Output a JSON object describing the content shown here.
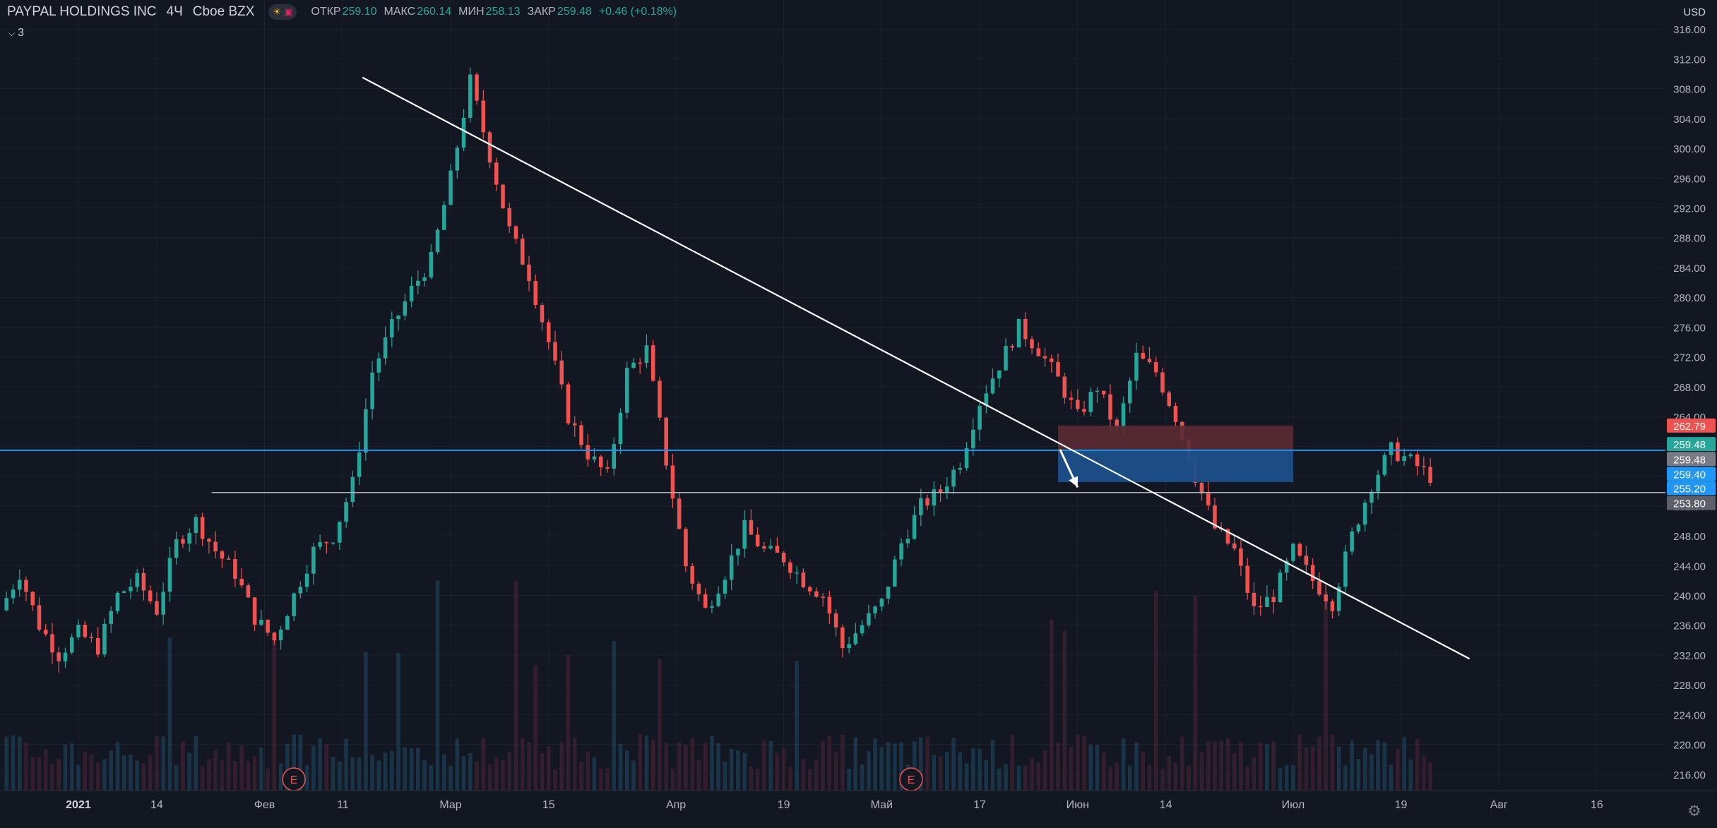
{
  "header": {
    "symbol": "PAYPAL HOLDINGS INC",
    "timeframe": "4Ч",
    "exchange": "Cboe BZX",
    "badge_icons": [
      "sun-icon",
      "flag-icon"
    ],
    "open_label": "ОТКР",
    "open_value": "259.10",
    "high_label": "МАКС",
    "high_value": "260.14",
    "low_label": "МИН",
    "low_value": "258.13",
    "close_label": "ЗАКР",
    "close_value": "259.48",
    "change": "+0.46 (+0.18%)",
    "indicators_count": "3"
  },
  "colors": {
    "background": "#131722",
    "up": "#26a69a",
    "down": "#ef5350",
    "trendline": "#ffffff",
    "hline_blue": "#2196f3",
    "hline_gray": "#b2b5be",
    "stop_zone": "#5b2a33",
    "target_zone": "#1c4f8a"
  },
  "chart_data": {
    "type": "candlestick",
    "currency": "USD",
    "ylim": [
      214,
      318
    ],
    "y_ticks": [
      "316.00",
      "312.00",
      "308.00",
      "304.00",
      "300.00",
      "296.00",
      "292.00",
      "288.00",
      "284.00",
      "280.00",
      "276.00",
      "272.00",
      "268.00",
      "264.00",
      "260.00",
      "256.00",
      "252.00",
      "248.00",
      "244.00",
      "240.00",
      "236.00",
      "232.00",
      "228.00",
      "224.00",
      "220.00",
      "216.00"
    ],
    "x_range": [
      0,
      85
    ],
    "x_ticks": [
      {
        "label": "2021",
        "x": 4,
        "bold": true
      },
      {
        "label": "14",
        "x": 8
      },
      {
        "label": "Фев",
        "x": 13.5
      },
      {
        "label": "11",
        "x": 17.5
      },
      {
        "label": "Мар",
        "x": 23
      },
      {
        "label": "15",
        "x": 28
      },
      {
        "label": "Апр",
        "x": 34.5
      },
      {
        "label": "19",
        "x": 40
      },
      {
        "label": "Май",
        "x": 45
      },
      {
        "label": "17",
        "x": 50
      },
      {
        "label": "Июн",
        "x": 55
      },
      {
        "label": "14",
        "x": 59.5
      },
      {
        "label": "Июл",
        "x": 66
      },
      {
        "label": "19",
        "x": 71.5
      },
      {
        "label": "Авг",
        "x": 76.5
      },
      {
        "label": "16",
        "x": 81.5
      }
    ],
    "closes": [
      [
        0,
        238
      ],
      [
        1,
        243
      ],
      [
        2,
        236
      ],
      [
        3,
        232
      ],
      [
        4,
        235
      ],
      [
        5,
        233
      ],
      [
        6,
        240
      ],
      [
        7,
        242
      ],
      [
        8,
        238
      ],
      [
        9,
        247
      ],
      [
        10,
        250
      ],
      [
        11,
        246
      ],
      [
        12,
        243
      ],
      [
        13,
        237
      ],
      [
        14,
        234
      ],
      [
        15,
        240
      ],
      [
        16,
        246
      ],
      [
        17,
        248
      ],
      [
        18,
        255
      ],
      [
        19,
        270
      ],
      [
        20,
        276
      ],
      [
        21,
        281
      ],
      [
        22,
        285
      ],
      [
        23,
        296
      ],
      [
        24,
        309
      ],
      [
        25,
        299
      ],
      [
        26,
        289
      ],
      [
        27,
        283
      ],
      [
        28,
        274
      ],
      [
        29,
        264
      ],
      [
        30,
        259
      ],
      [
        31,
        256
      ],
      [
        32,
        270
      ],
      [
        33,
        273
      ],
      [
        34,
        258
      ],
      [
        35,
        244
      ],
      [
        36,
        238
      ],
      [
        37,
        243
      ],
      [
        38,
        249
      ],
      [
        39,
        246
      ],
      [
        40,
        245
      ],
      [
        41,
        242
      ],
      [
        42,
        240
      ],
      [
        43,
        233
      ],
      [
        44,
        236
      ],
      [
        45,
        239
      ],
      [
        46,
        247
      ],
      [
        47,
        252
      ],
      [
        48,
        254
      ],
      [
        49,
        258
      ],
      [
        50,
        266
      ],
      [
        51,
        271
      ],
      [
        52,
        276
      ],
      [
        53,
        273
      ],
      [
        54,
        269
      ],
      [
        55,
        264
      ],
      [
        56,
        268
      ],
      [
        57,
        262
      ],
      [
        58,
        272
      ],
      [
        59,
        270
      ],
      [
        60,
        264
      ],
      [
        61,
        256
      ],
      [
        62,
        249
      ],
      [
        63,
        246
      ],
      [
        64,
        238
      ],
      [
        65,
        240
      ],
      [
        66,
        246
      ],
      [
        67,
        242
      ],
      [
        68,
        239
      ],
      [
        69,
        248
      ],
      [
        70,
        255
      ],
      [
        71,
        259.5
      ],
      [
        72,
        258
      ],
      [
        73,
        256
      ]
    ],
    "trendline": {
      "from": [
        18.5,
        309.5
      ],
      "to": [
        75,
        231.5
      ]
    },
    "horizontal_lines": [
      {
        "price": 259.48,
        "color": "blue"
      },
      {
        "price": 253.8,
        "color": "gray"
      }
    ],
    "short_position": {
      "x_start": 54,
      "x_end": 66,
      "entry": 259.4,
      "stop": 262.79,
      "target": 255.2
    },
    "arrow": {
      "from": [
        54.1,
        259.6
      ],
      "to": [
        55,
        254.5
      ]
    },
    "earnings_markers": [
      {
        "x": 15,
        "label": "E"
      },
      {
        "x": 46.5,
        "label": "E"
      }
    ],
    "price_labels": [
      {
        "value": "262.79",
        "price": 262.79,
        "color": "#ef5350"
      },
      {
        "value": "259.48",
        "price": 260.3,
        "color": "#26a69a"
      },
      {
        "value": "259.48",
        "price": 258.3,
        "color": "#787b86"
      },
      {
        "value": "259.40",
        "price": 256.3,
        "color": "#2196f3"
      },
      {
        "value": "255.20",
        "price": 254.4,
        "color": "#2196f3"
      },
      {
        "value": "253.80",
        "price": 252.4,
        "color": "#5d606b"
      }
    ]
  }
}
